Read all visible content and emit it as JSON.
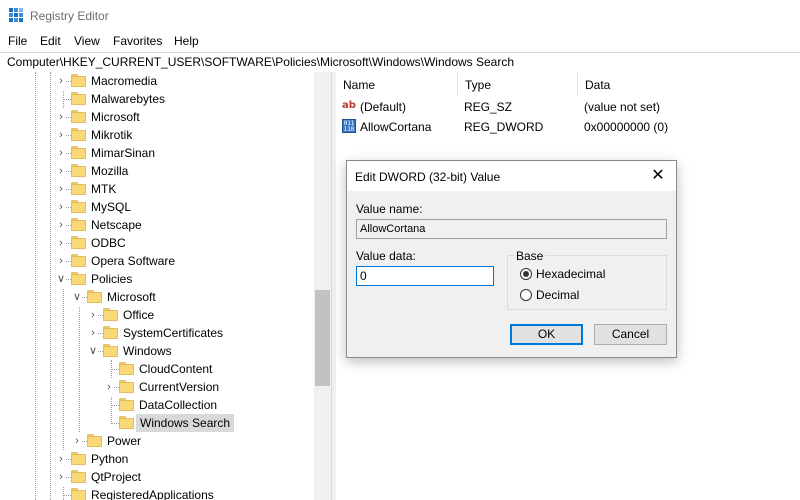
{
  "window": {
    "title": "Registry Editor"
  },
  "menu": [
    "File",
    "Edit",
    "View",
    "Favorites",
    "Help"
  ],
  "address": "Computer\\HKEY_CURRENT_USER\\SOFTWARE\\Policies\\Microsoft\\Windows\\Windows Search",
  "tree": {
    "items": [
      {
        "label": "Macromedia",
        "expandable": true,
        "expanded": false
      },
      {
        "label": "Malwarebytes",
        "expandable": false,
        "expanded": false
      },
      {
        "label": "Microsoft",
        "expandable": true,
        "expanded": false
      },
      {
        "label": "Mikrotik",
        "expandable": true,
        "expanded": false
      },
      {
        "label": "MimarSinan",
        "expandable": true,
        "expanded": false
      },
      {
        "label": "Mozilla",
        "expandable": true,
        "expanded": false
      },
      {
        "label": "MTK",
        "expandable": true,
        "expanded": false
      },
      {
        "label": "MySQL",
        "expandable": true,
        "expanded": false
      },
      {
        "label": "Netscape",
        "expandable": true,
        "expanded": false
      },
      {
        "label": "ODBC",
        "expandable": true,
        "expanded": false
      },
      {
        "label": "Opera Software",
        "expandable": true,
        "expanded": false
      },
      {
        "label": "Policies",
        "expandable": true,
        "expanded": true
      },
      {
        "label": "Microsoft",
        "expandable": true,
        "expanded": true
      },
      {
        "label": "Office",
        "expandable": true,
        "expanded": false
      },
      {
        "label": "SystemCertificates",
        "expandable": true,
        "expanded": false
      },
      {
        "label": "Windows",
        "expandable": true,
        "expanded": true
      },
      {
        "label": "CloudContent",
        "expandable": false,
        "expanded": false
      },
      {
        "label": "CurrentVersion",
        "expandable": true,
        "expanded": false
      },
      {
        "label": "DataCollection",
        "expandable": false,
        "expanded": false
      },
      {
        "label": "Windows Search",
        "expandable": false,
        "expanded": false,
        "selected": true
      },
      {
        "label": "Power",
        "expandable": true,
        "expanded": false
      },
      {
        "label": "Python",
        "expandable": true,
        "expanded": false
      },
      {
        "label": "QtProject",
        "expandable": true,
        "expanded": false
      },
      {
        "label": "RegisteredApplications",
        "expandable": false,
        "expanded": false
      }
    ]
  },
  "list": {
    "columns": [
      "Name",
      "Type",
      "Data"
    ],
    "rows": [
      {
        "icon": "string-value-icon",
        "name": "(Default)",
        "type": "REG_SZ",
        "data": "(value not set)"
      },
      {
        "icon": "binary-value-icon",
        "name": "AllowCortana",
        "type": "REG_DWORD",
        "data": "0x00000000 (0)"
      }
    ]
  },
  "dialog": {
    "title": "Edit DWORD (32-bit) Value",
    "value_name_label": "Value name:",
    "value_name": "AllowCortana",
    "value_data_label": "Value data:",
    "value_data": "0",
    "base_label": "Base",
    "base_options": [
      "Hexadecimal",
      "Decimal"
    ],
    "base_selected": "Hexadecimal",
    "ok_label": "OK",
    "cancel_label": "Cancel",
    "close_glyph": "✕"
  },
  "colors": {
    "accent": "#0078d7",
    "folder": "#f9d977",
    "selection": "#d9d9d9"
  }
}
